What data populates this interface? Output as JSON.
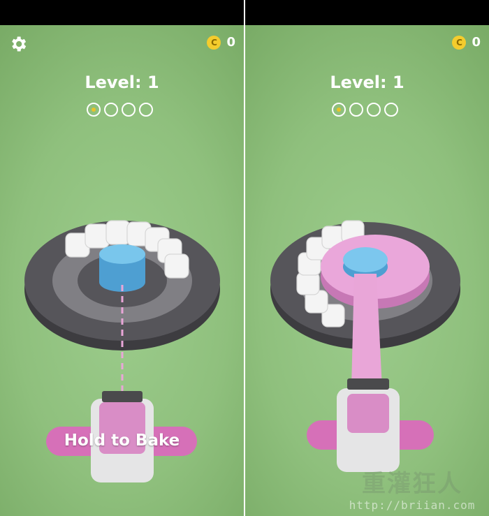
{
  "left_panel": {
    "level_label": "Level: 1",
    "coin_symbol": "C",
    "coin_count": "0",
    "hold_label": "Hold to Bake",
    "progress": {
      "total": 4,
      "current": 1
    }
  },
  "right_panel": {
    "level_label": "Level: 1",
    "coin_symbol": "C",
    "coin_count": "0",
    "progress": {
      "total": 4,
      "current": 1
    }
  },
  "watermark": {
    "cn_text": "重灌狂人",
    "url_text": "http://briian.com"
  },
  "colors": {
    "background_green": "#8fc07d",
    "pink": "#e9a6d8",
    "cake_blue": "#6fbfe6",
    "plate_dark": "#555459",
    "coin_gold": "#f4cc2d"
  }
}
